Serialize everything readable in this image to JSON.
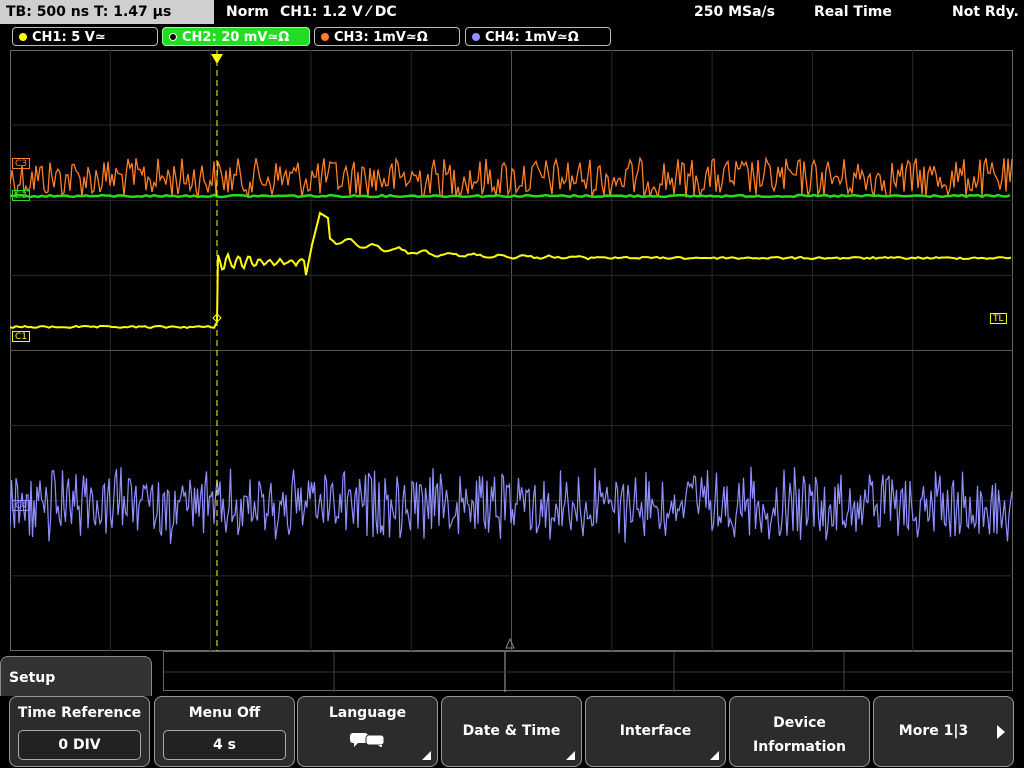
{
  "topbar": {
    "timebase": "TB: 500 ns   T: 1.47 µs",
    "mode": "Norm",
    "trigger": "CH1: 1.2 V ⁄ DC",
    "samplerate": "250 MSa/s",
    "acq": "Real Time",
    "status": "Not Rdy."
  },
  "channels": [
    {
      "label": "CH1: 5 V≃",
      "color": "#ffff00"
    },
    {
      "label": "CH2: 20 mV≃Ω",
      "color": "#00ff00",
      "active": true
    },
    {
      "label": "CH3: 1mV≃Ω",
      "color": "#ff8c2a"
    },
    {
      "label": "CH4: 1mV≃Ω",
      "color": "#8f8fff"
    }
  ],
  "markers": {
    "ch1": "C1",
    "ch2": "C2",
    "ch3": "C3",
    "ch4": "C4",
    "trigger_level": "TL",
    "trigger_pos": "T"
  },
  "menu": {
    "tab": "Setup",
    "buttons": [
      {
        "label": "Time Reference",
        "value": "0 DIV"
      },
      {
        "label": "Menu Off",
        "value": "4 s"
      },
      {
        "label": "Language"
      },
      {
        "label": "Date & Time"
      },
      {
        "label": "Interface"
      },
      {
        "label": "Device",
        "label2": "Information"
      },
      {
        "label": "More 1|3"
      }
    ]
  },
  "colors": {
    "ch1": "#ffff00",
    "ch2": "#00dd00",
    "ch3": "#ff7f27",
    "ch4": "#8f8fff",
    "grid": "#555555"
  }
}
